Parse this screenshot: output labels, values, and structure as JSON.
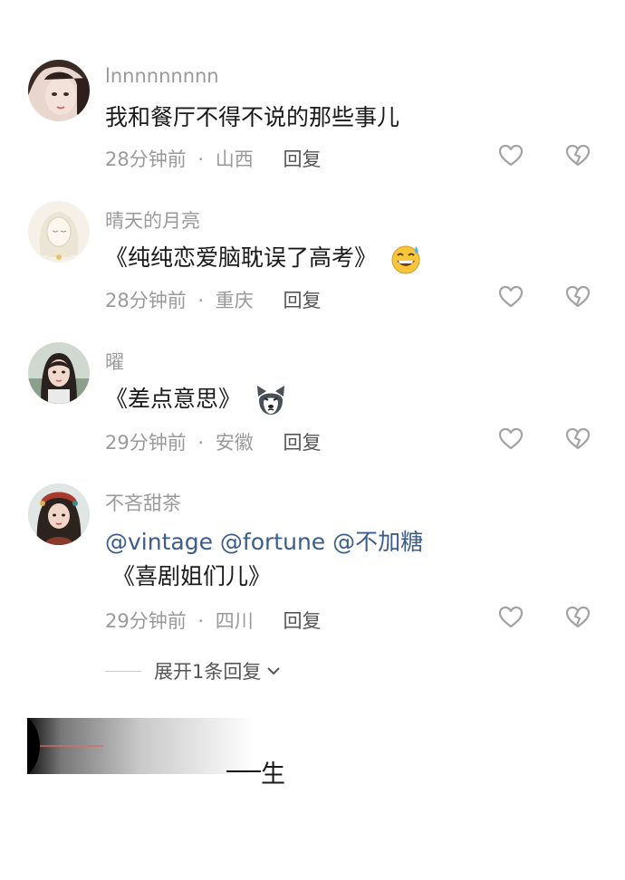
{
  "comments": [
    {
      "username": "lnnnnnnnnn",
      "text": "我和餐厅不得不说的那些事儿",
      "time": "28分钟前",
      "separator": "·",
      "location": "山西",
      "reply_label": "回复"
    },
    {
      "username": "晴天的月亮",
      "text": "《纯纯恋爱脑耽误了高考》",
      "emoji": "sweat-grin-emoji",
      "time": "28分钟前",
      "separator": "·",
      "location": "重庆",
      "reply_label": "回复"
    },
    {
      "username": "曜",
      "text": "《差点意思》",
      "emoji": "husky-dog-emoji",
      "time": "29分钟前",
      "separator": "·",
      "location": "安徽",
      "reply_label": "回复"
    },
    {
      "username": "不吝甜茶",
      "mentions": [
        "@vintage",
        "@fortune",
        "@不加糖"
      ],
      "text": "《喜剧姐们儿》",
      "time": "29分钟前",
      "separator": "·",
      "location": "四川",
      "reply_label": "回复"
    }
  ],
  "expand_replies": "展开1条回复",
  "partial_bottom_text": "生",
  "icons": {
    "like": "heart-outline-icon",
    "dislike": "broken-heart-icon",
    "expand": "chevron-down-icon"
  },
  "colors": {
    "meta_gray": "#9a9a9a",
    "mention_blue": "#3b5d8c",
    "text": "#1a1a1a"
  }
}
